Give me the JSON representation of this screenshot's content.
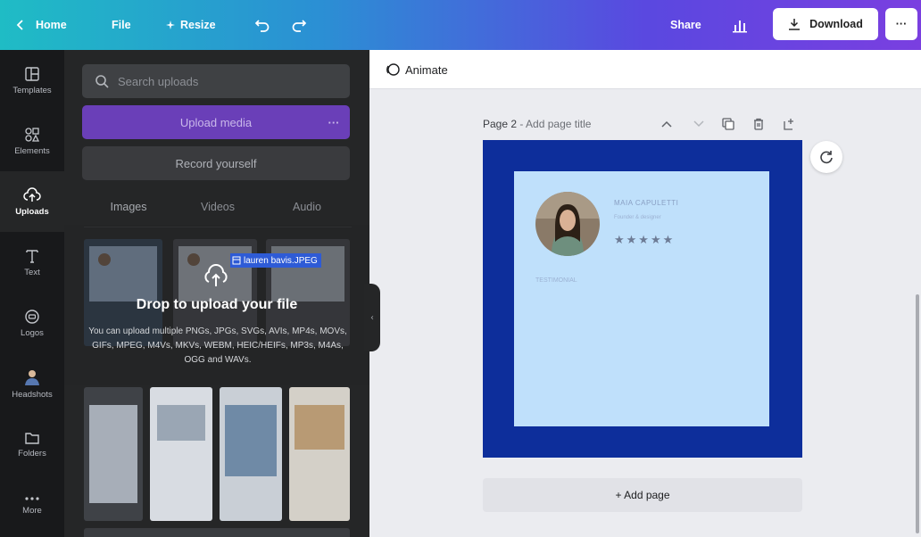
{
  "topbar": {
    "home_label": "Home",
    "file_label": "File",
    "resize_label": "Resize",
    "share_label": "Share",
    "download_label": "Download",
    "more_label": "···"
  },
  "rail": {
    "items": [
      {
        "label": "Templates",
        "icon": "templates-icon"
      },
      {
        "label": "Elements",
        "icon": "elements-icon"
      },
      {
        "label": "Uploads",
        "icon": "uploads-icon"
      },
      {
        "label": "Text",
        "icon": "text-icon"
      },
      {
        "label": "Logos",
        "icon": "logos-icon"
      },
      {
        "label": "Headshots",
        "icon": "headshots-icon"
      },
      {
        "label": "Folders",
        "icon": "folders-icon"
      },
      {
        "label": "More",
        "icon": "more-icon"
      }
    ],
    "active": "Uploads"
  },
  "panel": {
    "search_placeholder": "Search uploads",
    "upload_media_label": "Upload media",
    "upload_more_label": "···",
    "record_label": "Record yourself",
    "tabs": [
      "Images",
      "Videos",
      "Audio"
    ],
    "drag_file_name": "lauren bavis.JPEG",
    "drop_title": "Drop to upload your file",
    "drop_subtitle": "You can upload multiple PNGs, JPGs, SVGs, AVIs, MP4s, MOVs, GIFs, MPEG, M4Vs, MKVs, WEBM, HEIC/HEIFs, MP3s, M4As, OGG and WAVs."
  },
  "canvas": {
    "animate_label": "Animate",
    "page_label": "Page 2",
    "page_title_hint": " - Add page title",
    "add_page_label": "+ Add page",
    "card": {
      "name": "MAIA CAPULETTI",
      "role": "Founder & designer",
      "stars": "★★★★★",
      "testimonial_hint": "TESTIMONIAL"
    }
  },
  "colors": {
    "page_background": "#0d2e9b",
    "card_background": "#bfe0fb",
    "upload_button": "#6a3fb8"
  }
}
